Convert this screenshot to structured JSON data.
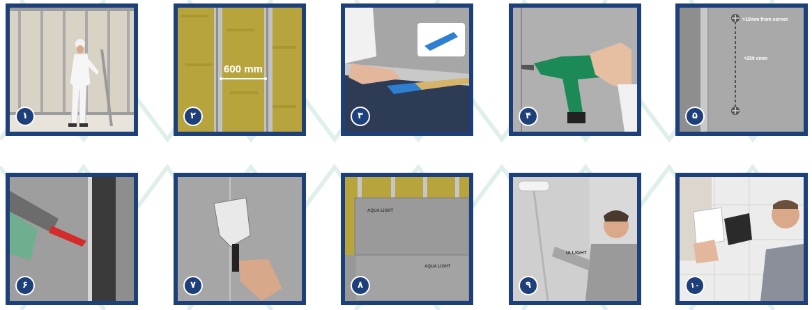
{
  "steps": [
    {
      "number": "۱",
      "icon": "worker-installing-studs"
    },
    {
      "number": "۲",
      "icon": "insulation-between-studs"
    },
    {
      "number": "۳",
      "icon": "cutting-board-with-knife"
    },
    {
      "number": "۴",
      "icon": "drill-screwing-board"
    },
    {
      "number": "۵",
      "icon": "screw-spacing-diagram"
    },
    {
      "number": "۶",
      "icon": "sealant-gun-at-joint"
    },
    {
      "number": "۷",
      "icon": "spatula-filling-joint"
    },
    {
      "number": "۸",
      "icon": "boards-over-insulation"
    },
    {
      "number": "۹",
      "icon": "paint-roller-on-wall"
    },
    {
      "number": "۱۰",
      "icon": "tiling-on-board"
    }
  ],
  "labels": {
    "stud_spacing": "600 mm",
    "corner_distance": ">15mm from corner",
    "screw_spacing": "<250 cmm",
    "board_brand": "AQUA LIGHT",
    "board_brand_short": "IA LIGHT"
  },
  "colors": {
    "frame": "#1d3f7a",
    "pattern": "#dff0ea",
    "insulation": "#b8a43c"
  }
}
